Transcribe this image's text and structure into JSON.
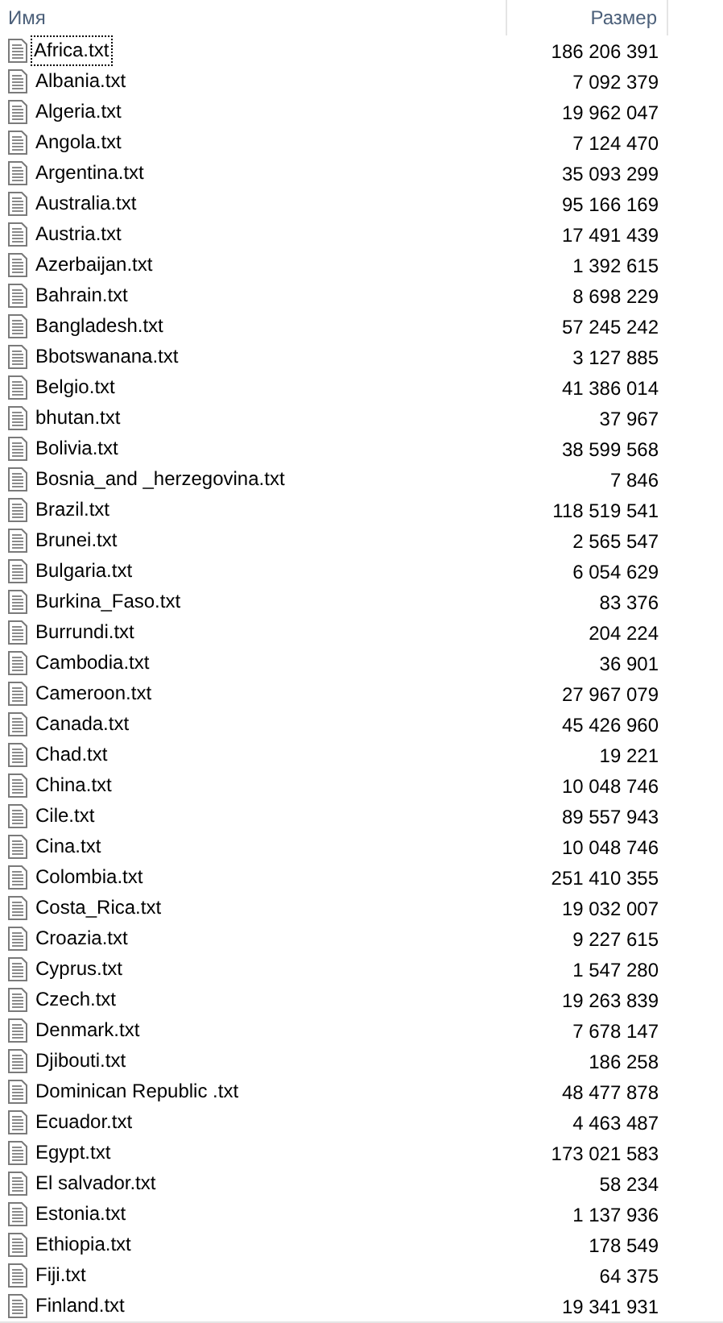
{
  "columns": [
    {
      "label": "Имя"
    },
    {
      "label": "Размер"
    }
  ],
  "files": [
    {
      "name": "Africa.txt",
      "size": "186 206 391",
      "focused": true
    },
    {
      "name": "Albania.txt",
      "size": "7 092 379",
      "focused": false
    },
    {
      "name": "Algeria.txt",
      "size": "19 962 047",
      "focused": false
    },
    {
      "name": "Angola.txt",
      "size": "7 124 470",
      "focused": false
    },
    {
      "name": "Argentina.txt",
      "size": "35 093 299",
      "focused": false
    },
    {
      "name": "Australia.txt",
      "size": "95 166 169",
      "focused": false
    },
    {
      "name": "Austria.txt",
      "size": "17 491 439",
      "focused": false
    },
    {
      "name": "Azerbaijan.txt",
      "size": "1 392 615",
      "focused": false
    },
    {
      "name": "Bahrain.txt",
      "size": "8 698 229",
      "focused": false
    },
    {
      "name": "Bangladesh.txt",
      "size": "57 245 242",
      "focused": false
    },
    {
      "name": "Bbotswanana.txt",
      "size": "3 127 885",
      "focused": false
    },
    {
      "name": "Belgio.txt",
      "size": "41 386 014",
      "focused": false
    },
    {
      "name": "bhutan.txt",
      "size": "37 967",
      "focused": false
    },
    {
      "name": "Bolivia.txt",
      "size": "38 599 568",
      "focused": false
    },
    {
      "name": "Bosnia_and _herzegovina.txt",
      "size": "7 846",
      "focused": false
    },
    {
      "name": "Brazil.txt",
      "size": "118 519 541",
      "focused": false
    },
    {
      "name": "Brunei.txt",
      "size": "2 565 547",
      "focused": false
    },
    {
      "name": "Bulgaria.txt",
      "size": "6 054 629",
      "focused": false
    },
    {
      "name": "Burkina_Faso.txt",
      "size": "83 376",
      "focused": false
    },
    {
      "name": "Burrundi.txt",
      "size": "204 224",
      "focused": false
    },
    {
      "name": "Cambodia.txt",
      "size": "36 901",
      "focused": false
    },
    {
      "name": "Cameroon.txt",
      "size": "27 967 079",
      "focused": false
    },
    {
      "name": "Canada.txt",
      "size": "45 426 960",
      "focused": false
    },
    {
      "name": "Chad.txt",
      "size": "19 221",
      "focused": false
    },
    {
      "name": "China.txt",
      "size": "10 048 746",
      "focused": false
    },
    {
      "name": "Cile.txt",
      "size": "89 557 943",
      "focused": false
    },
    {
      "name": "Cina.txt",
      "size": "10 048 746",
      "focused": false
    },
    {
      "name": "Colombia.txt",
      "size": "251 410 355",
      "focused": false
    },
    {
      "name": "Costa_Rica.txt",
      "size": "19 032 007",
      "focused": false
    },
    {
      "name": "Croazia.txt",
      "size": "9 227 615",
      "focused": false
    },
    {
      "name": "Cyprus.txt",
      "size": "1 547 280",
      "focused": false
    },
    {
      "name": "Czech.txt",
      "size": "19 263 839",
      "focused": false
    },
    {
      "name": "Denmark.txt",
      "size": "7 678 147",
      "focused": false
    },
    {
      "name": "Djibouti.txt",
      "size": "186 258",
      "focused": false
    },
    {
      "name": "Dominican Republic .txt",
      "size": "48 477 878",
      "focused": false
    },
    {
      "name": "Ecuador.txt",
      "size": "4 463 487",
      "focused": false
    },
    {
      "name": "Egypt.txt",
      "size": "173 021 583",
      "focused": false
    },
    {
      "name": "El salvador.txt",
      "size": "58 234",
      "focused": false
    },
    {
      "name": "Estonia.txt",
      "size": "1 137 936",
      "focused": false
    },
    {
      "name": "Ethiopia.txt",
      "size": "178 549",
      "focused": false
    },
    {
      "name": "Fiji.txt",
      "size": "64 375",
      "focused": false
    },
    {
      "name": "Finland.txt",
      "size": "19 341 931",
      "focused": false
    }
  ]
}
